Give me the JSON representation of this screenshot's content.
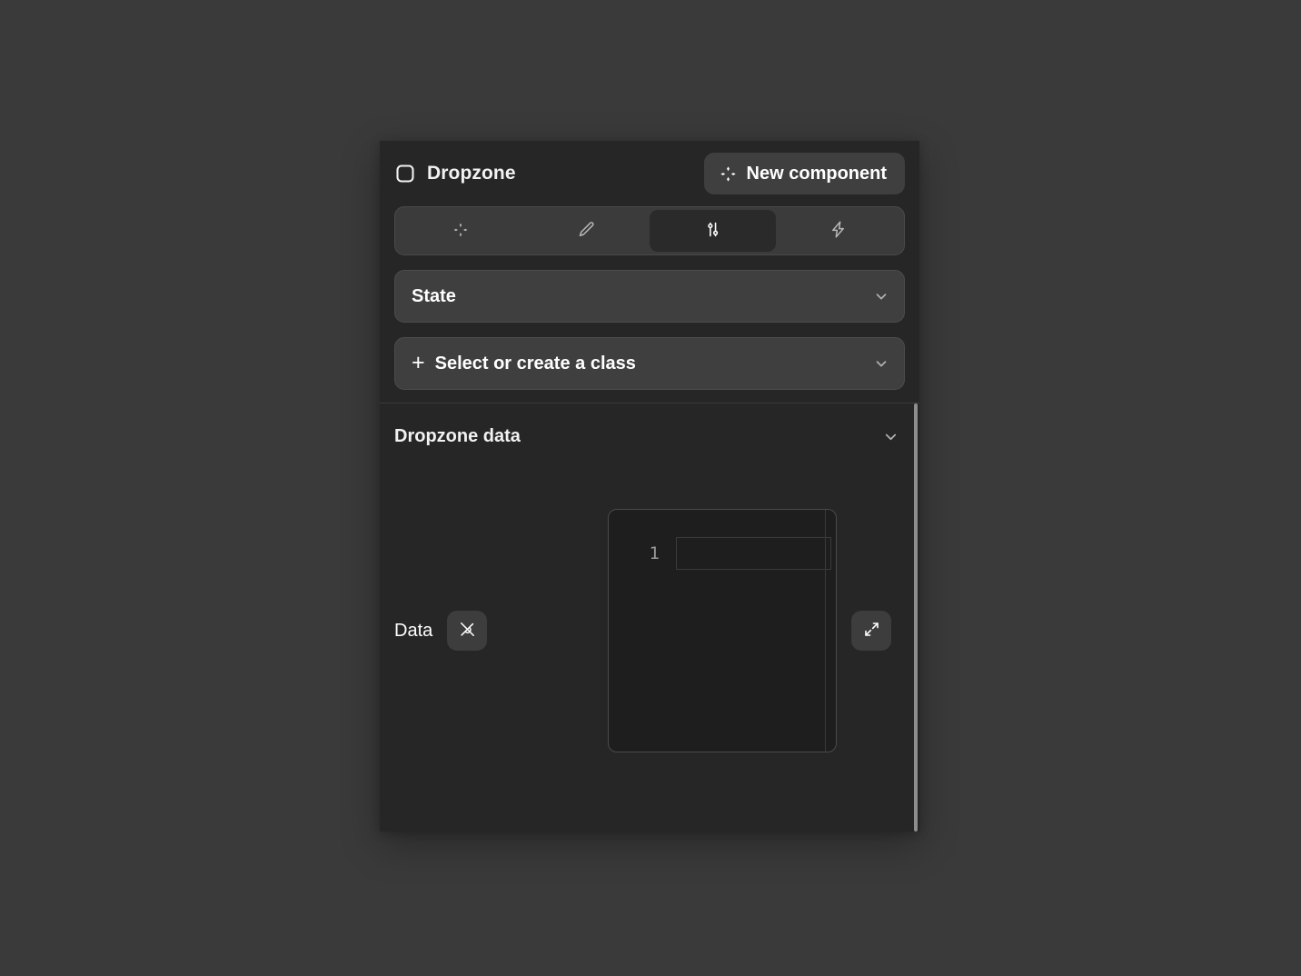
{
  "panel": {
    "header": {
      "icon": "rounded-square-icon",
      "title": "Dropzone",
      "new_component_button": {
        "label": "New component",
        "icon": "sparkle-icon"
      }
    },
    "tabs": [
      {
        "name": "ai",
        "icon": "sparkle-icon",
        "active": false
      },
      {
        "name": "edit",
        "icon": "pencil-icon",
        "active": false
      },
      {
        "name": "settings",
        "icon": "sliders-icon",
        "active": true
      },
      {
        "name": "actions",
        "icon": "lightning-icon",
        "active": false
      }
    ],
    "state_select": {
      "label": "State",
      "icon": "chevron-down-icon"
    },
    "class_select": {
      "plus": "+",
      "label": "Select or create a class",
      "icon": "chevron-down-icon"
    },
    "data_section": {
      "title": "Dropzone data",
      "collapse_icon": "chevron-down-icon",
      "data_field": {
        "label": "Data",
        "bind_icon": "plug-unplug-icon",
        "expand_icon": "expand-arrows-icon",
        "editor": {
          "line_numbers": [
            "1"
          ],
          "value": ""
        }
      }
    }
  },
  "colors": {
    "page_background": "#3a3a3a",
    "panel_background": "#262626",
    "control_background": "#3f3f3f",
    "active_tab_background": "#2a2a2a",
    "editor_background": "#1e1e1e",
    "text_primary": "#ffffff",
    "text_muted": "#9a9a9a",
    "scrollbar": "#8d8d8d"
  }
}
